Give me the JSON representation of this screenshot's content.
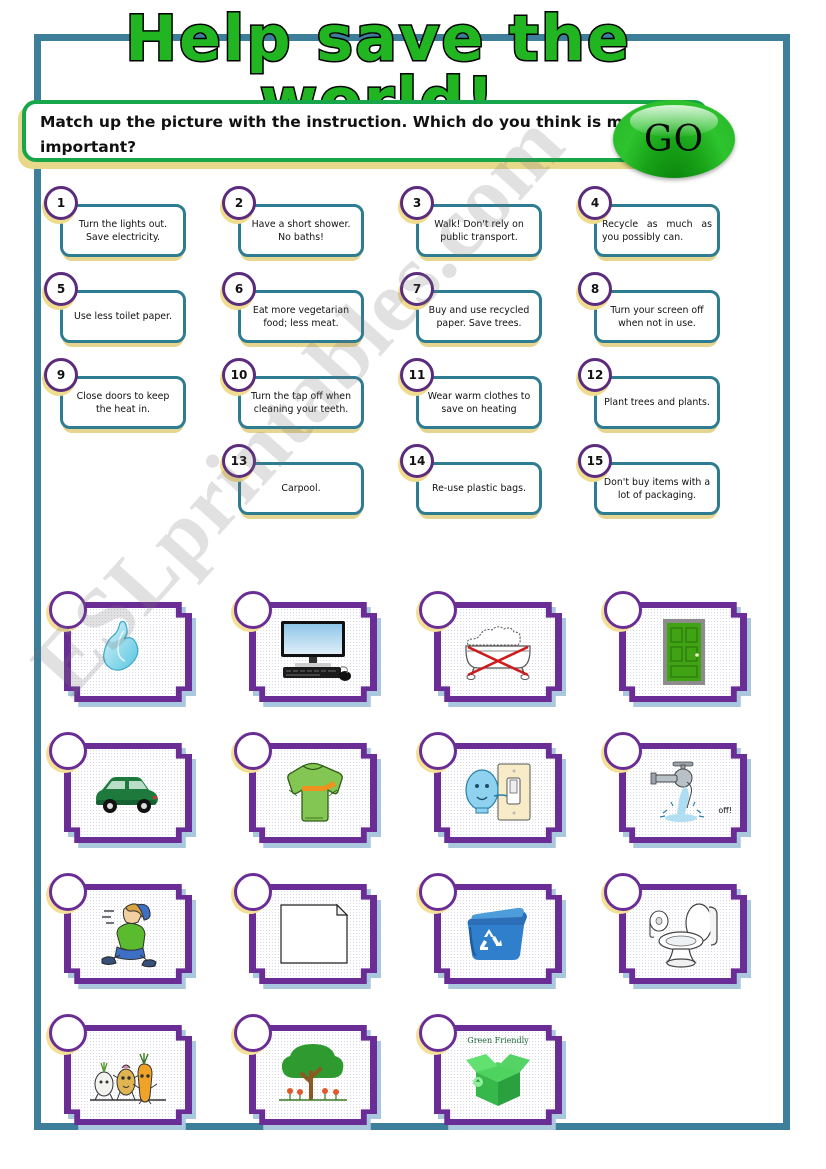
{
  "page": {
    "title": "Help save the world!",
    "instruction": "Match up the picture with the instruction. Which do you think is most important?",
    "go_label": "GO",
    "watermark": "ESLprintables.com"
  },
  "colors": {
    "frame": "#3d7f9b",
    "title_green": "#21b521",
    "banner_green": "#17a74a",
    "box_teal": "#2e7c91",
    "circle_purple": "#5b2b7d",
    "card_purple": "#6a2d95",
    "shadow_yellow": "#e8d98a"
  },
  "instructions": [
    {
      "number": "1",
      "text": "Turn the lights out. Save electricity."
    },
    {
      "number": "2",
      "text": "Have a short shower. No baths!"
    },
    {
      "number": "3",
      "text": "Walk! Don't rely on public transport."
    },
    {
      "number": "4",
      "text": "Recycle as much as you possibly can."
    },
    {
      "number": "5",
      "text": "Use less toilet paper."
    },
    {
      "number": "6",
      "text": "Eat more vegetarian food; less meat."
    },
    {
      "number": "7",
      "text": "Buy and use recycled paper. Save trees."
    },
    {
      "number": "8",
      "text": "Turn your screen off when not in use."
    },
    {
      "number": "9",
      "text": "Close doors to keep the heat in."
    },
    {
      "number": "10",
      "text": "Turn the tap off when cleaning your teeth."
    },
    {
      "number": "11",
      "text": "Wear warm clothes to save on heating"
    },
    {
      "number": "12",
      "text": "Plant trees and plants."
    },
    {
      "number": "13",
      "text": "Carpool."
    },
    {
      "number": "14",
      "text": "Re-use plastic bags."
    },
    {
      "number": "15",
      "text": "Don't buy items with a lot of packaging."
    }
  ],
  "pictures": [
    {
      "icon": "plastic-bag-icon",
      "label": ""
    },
    {
      "icon": "computer-screen-icon",
      "label": ""
    },
    {
      "icon": "bathtub-crossed-icon",
      "label": ""
    },
    {
      "icon": "green-door-icon",
      "label": ""
    },
    {
      "icon": "green-car-icon",
      "label": ""
    },
    {
      "icon": "green-sweater-icon",
      "label": ""
    },
    {
      "icon": "lightbulb-switch-icon",
      "label": ""
    },
    {
      "icon": "running-tap-icon",
      "label": "off!"
    },
    {
      "icon": "walking-boy-icon",
      "label": ""
    },
    {
      "icon": "paper-sheet-icon",
      "label": ""
    },
    {
      "icon": "recycling-bin-icon",
      "label": ""
    },
    {
      "icon": "toilet-icon",
      "label": ""
    },
    {
      "icon": "vegetables-icon",
      "label": ""
    },
    {
      "icon": "tree-flowers-icon",
      "label": ""
    },
    {
      "icon": "green-friendly-box-icon",
      "label": "Green Friendly"
    }
  ]
}
